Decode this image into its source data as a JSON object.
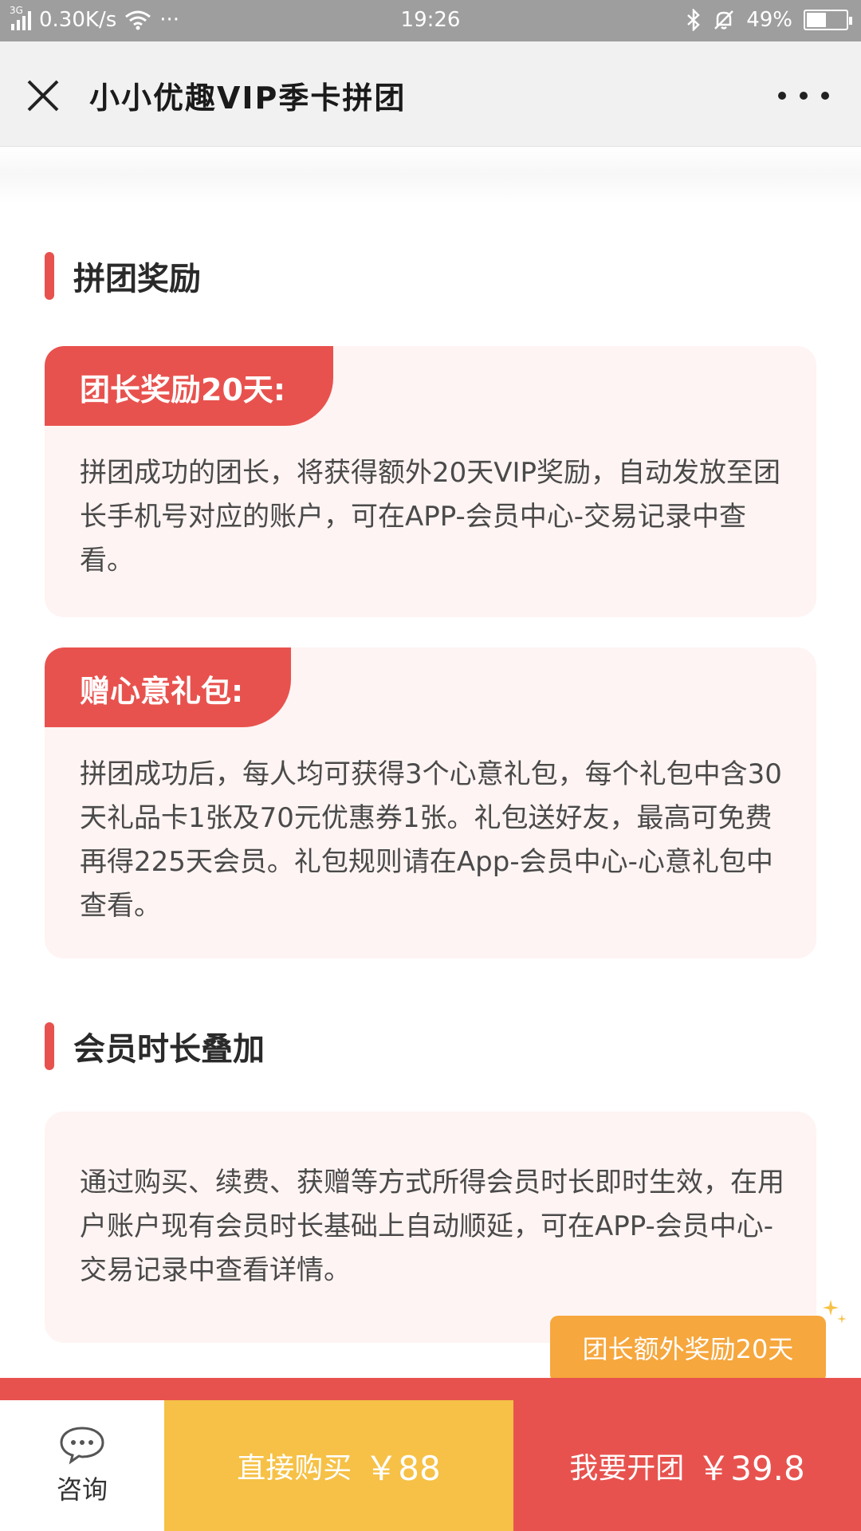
{
  "status_bar": {
    "network": "3G",
    "speed": "0.30K/s",
    "dots": "···",
    "time": "19:26",
    "battery": "49%",
    "battery_level": 0.49
  },
  "title_bar": {
    "title": "小小优趣VIP季卡拼团"
  },
  "sections": [
    {
      "title": "拼团奖励"
    },
    {
      "title": "会员时长叠加"
    }
  ],
  "cards": [
    {
      "tag": "团长奖励20天:",
      "body": "拼团成功的团长，将获得额外20天VIP奖励，自动发放至团长手机号对应的账户，可在APP-会员中心-交易记录中查看。"
    },
    {
      "tag": "赠心意礼包:",
      "body": "拼团成功后，每人均可获得3个心意礼包，每个礼包中含30天礼品卡1张及70元优惠券1张。礼包送好友，最高可免费再得225天会员。礼包规则请在App-会员中心-心意礼包中查看。"
    },
    {
      "tag": "",
      "body": "通过购买、续费、获赠等方式所得会员时长即时生效，在用户账户现有会员时长基础上自动顺延，可在APP-会员中心-交易记录中查看详情。"
    }
  ],
  "badge": {
    "text": "团长额外奖励20天"
  },
  "bottom_bar": {
    "consult_label": "咨询",
    "buy_label": "直接购买",
    "buy_price": "￥88",
    "group_label": "我要开团",
    "group_price": "￥39.8"
  },
  "colors": {
    "accent_red": "#e8524e",
    "accent_yellow": "#f6c146",
    "badge_orange": "#f6a73d",
    "card_bg": "#fef4f3"
  }
}
